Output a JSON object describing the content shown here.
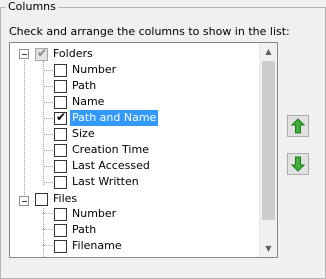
{
  "group": {
    "title": "Columns"
  },
  "instruction": "Check and arrange the columns to show in the list:",
  "tree": {
    "folders": {
      "label": "Folders",
      "checked": true,
      "children": [
        {
          "label": "Number",
          "checked": false
        },
        {
          "label": "Path",
          "checked": false
        },
        {
          "label": "Name",
          "checked": false
        },
        {
          "label": "Path and Name",
          "checked": true,
          "selected": true
        },
        {
          "label": "Size",
          "checked": false
        },
        {
          "label": "Creation Time",
          "checked": false
        },
        {
          "label": "Last Accessed",
          "checked": false
        },
        {
          "label": "Last Written",
          "checked": false
        }
      ]
    },
    "files": {
      "label": "Files",
      "checked": false,
      "children": [
        {
          "label": "Number",
          "checked": false
        },
        {
          "label": "Path",
          "checked": false
        },
        {
          "label": "Filename",
          "checked": false
        }
      ]
    }
  },
  "icons": {
    "move_up": "green-up-arrow-icon",
    "move_down": "green-down-arrow-icon",
    "check": "✔"
  },
  "colors": {
    "selection": "#3399ff",
    "arrow_green": "#3fae3c"
  }
}
